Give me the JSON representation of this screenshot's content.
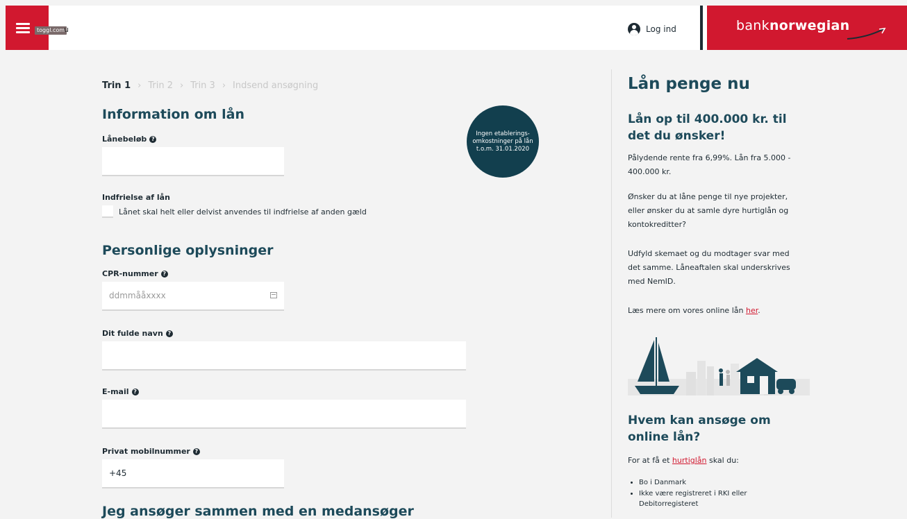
{
  "header": {
    "menu_tooltip": "toggl.com",
    "menu_text": "u",
    "login_label": "Log ind",
    "brand_bank": "bank",
    "brand_norwegian": "norwegian"
  },
  "steps": [
    {
      "label": "Trin 1"
    },
    {
      "label": "Trin 2"
    },
    {
      "label": "Trin 3"
    },
    {
      "label": "Indsend ansøgning"
    }
  ],
  "loan_section": {
    "title": "Information om lån",
    "amount_label": "Lånebeløb",
    "amount_value": "",
    "redemption_label": "Indfrielse af lån",
    "redemption_checkbox_label": "Lånet skal helt eller delvist anvendes til indfrielse af anden gæld"
  },
  "badge_text": "Ingen etablerings-omkostninger på lån t.o.m. 31.01.2020",
  "personal_section": {
    "title": "Personlige oplysninger",
    "cpr_label": "CPR-nummer",
    "cpr_placeholder": "ddmmååxxxx",
    "name_label": "Dit fulde navn",
    "email_label": "E-mail",
    "phone_label": "Privat mobilnummer",
    "phone_value": "+45"
  },
  "co_applicant_title": "Jeg ansøger sammen med en medansøger",
  "sidebar": {
    "title": "Lån penge nu",
    "subtitle": "Lån op til 400.000 kr. til det du ønsker!",
    "p1": "Pålydende rente fra 6,99%. Lån fra 5.000 - 400.000 kr.",
    "p2": "Ønsker du at låne penge til nye projekter, eller ønsker du at samle dyre hurtiglån og kontokreditter?",
    "p3": "Udfyld skemaet og du modtager svar med det samme. Låneaftalen skal underskrives med NemID.",
    "p4_before": "Læs mere om vores online lån ",
    "p4_link": "her",
    "p4_after": ".",
    "subtitle2": "Hvem kan ansøge om online lån?",
    "p5_before": "For at få et ",
    "p5_link": "hurtiglån",
    "p5_after": " skal du:",
    "requirements": [
      "Bo i Danmark",
      "Ikke være registreret i RKI eller Debitorregisteret"
    ]
  },
  "colors": {
    "brand_red": "#d1182f",
    "heading_teal": "#1d4a5a",
    "badge_bg": "#123f4e"
  }
}
